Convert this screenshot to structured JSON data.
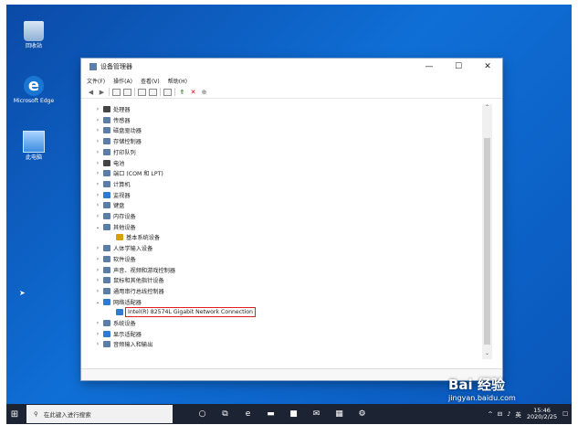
{
  "desktop": {
    "icons": [
      {
        "label": "回收站",
        "icon": "recycle-bin-icon"
      },
      {
        "label": "Microsoft Edge",
        "icon": "edge-icon"
      },
      {
        "label": "此电脑",
        "icon": "computer-icon"
      }
    ]
  },
  "window": {
    "title": "设备管理器",
    "controls": {
      "minimize": "—",
      "maximize": "☐",
      "close": "✕"
    },
    "menu": [
      "文件(F)",
      "操作(A)",
      "查看(V)",
      "帮助(H)"
    ],
    "tree": [
      {
        "chev": "›",
        "label": "处理器",
        "icon": "processor-icon"
      },
      {
        "chev": "›",
        "label": "传感器",
        "icon": "sensor-icon"
      },
      {
        "chev": "›",
        "label": "磁盘驱动器",
        "icon": "disk-drive-icon"
      },
      {
        "chev": "›",
        "label": "存储控制器",
        "icon": "storage-controller-icon"
      },
      {
        "chev": "›",
        "label": "打印队列",
        "icon": "print-queue-icon"
      },
      {
        "chev": "›",
        "label": "电池",
        "icon": "battery-icon"
      },
      {
        "chev": "›",
        "label": "端口 (COM 和 LPT)",
        "icon": "port-icon"
      },
      {
        "chev": "›",
        "label": "计算机",
        "icon": "computer-icon"
      },
      {
        "chev": "›",
        "label": "监视器",
        "icon": "monitor-icon"
      },
      {
        "chev": "›",
        "label": "键盘",
        "icon": "keyboard-icon"
      },
      {
        "chev": "›",
        "label": "内存设备",
        "icon": "memory-icon"
      },
      {
        "chev": "⌄",
        "label": "其他设备",
        "icon": "other-devices-icon"
      },
      {
        "chev": "",
        "label": "基本系统设备",
        "icon": "warning-device-icon",
        "indent": 1
      },
      {
        "chev": "›",
        "label": "人体学输入设备",
        "icon": "hid-icon"
      },
      {
        "chev": "›",
        "label": "软件设备",
        "icon": "software-device-icon"
      },
      {
        "chev": "›",
        "label": "声音、视频和游戏控制器",
        "icon": "sound-icon"
      },
      {
        "chev": "›",
        "label": "鼠标和其他指针设备",
        "icon": "mouse-icon"
      },
      {
        "chev": "›",
        "label": "通用串行总线控制器",
        "icon": "usb-icon"
      },
      {
        "chev": "⌄",
        "label": "网络适配器",
        "icon": "network-adapter-icon"
      },
      {
        "chev": "",
        "label": "Intel(R) 82574L Gigabit Network Connection",
        "icon": "network-card-icon",
        "indent": 1,
        "highlight": true
      },
      {
        "chev": "›",
        "label": "系统设备",
        "icon": "system-device-icon"
      },
      {
        "chev": "›",
        "label": "显示适配器",
        "icon": "display-adapter-icon"
      },
      {
        "chev": "›",
        "label": "音频输入和输出",
        "icon": "audio-io-icon"
      }
    ]
  },
  "taskbar": {
    "search_placeholder": "在此键入进行搜索",
    "time": "15:46",
    "date": "2020/2/25",
    "ime": "英"
  },
  "watermark": {
    "text": "Bai 经验",
    "url": "jingyan.baidu.com"
  }
}
